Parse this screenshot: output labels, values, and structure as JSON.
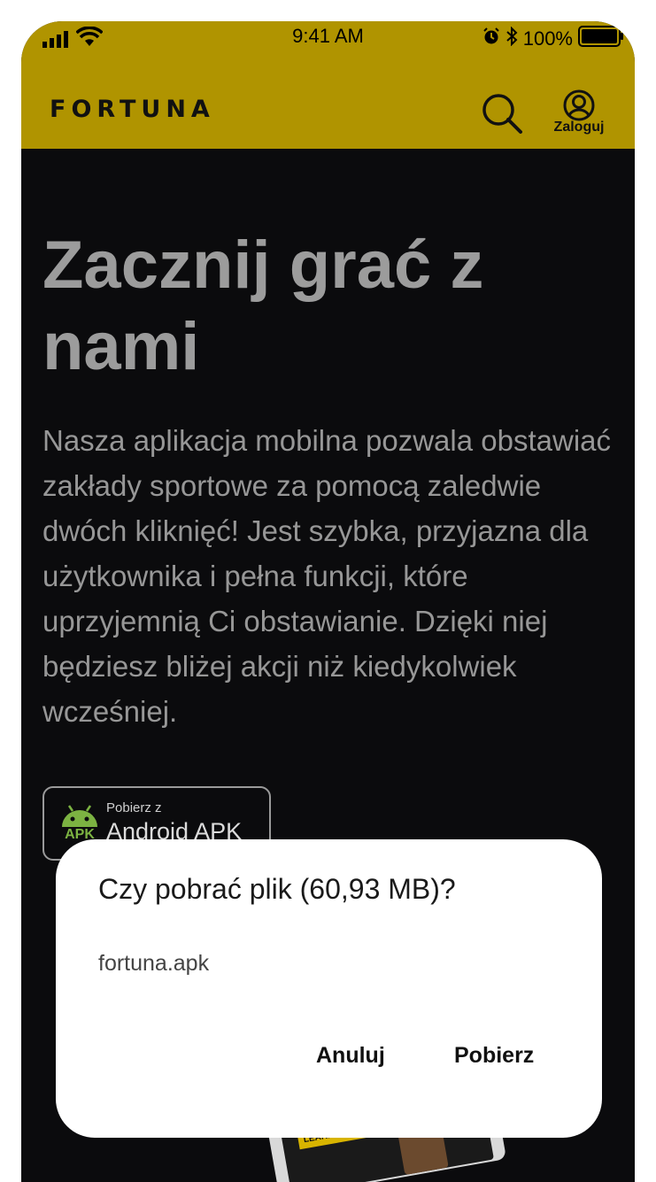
{
  "status_bar": {
    "time": "9:41 AM",
    "battery": "100%",
    "icons": [
      "signal-icon",
      "wifi-icon",
      "alarm-icon",
      "bluetooth-icon",
      "battery-icon"
    ]
  },
  "header": {
    "logo": "FORTUNA",
    "search_icon": "search-icon",
    "login_label": "Zaloguj",
    "brand_color": "#b09400"
  },
  "hero": {
    "title": "Zacznij grać z nami",
    "text": "Nasza aplikacja mobilna pozwala obstawiać zakłady sportowe za pomocą zaledwie dwóch kliknięć! Jest szybka, przyjazna dla użytkownika i pełna funkcji, które uprzyjemnią Ci obstawianie. Dzięki niej będziesz bliżej akcji niż kiedykolwiek wcześniej."
  },
  "apk_button": {
    "icon": "android-icon",
    "icon_text": "APK",
    "small_label": "Pobierz z",
    "big_label": "Android APK"
  },
  "promo": {
    "button_label": "LEARN MORE"
  },
  "dialog": {
    "title": "Czy pobrać plik (60,93 MB)?",
    "filename": "fortuna.apk",
    "cancel_label": "Anuluj",
    "download_label": "Pobierz"
  }
}
